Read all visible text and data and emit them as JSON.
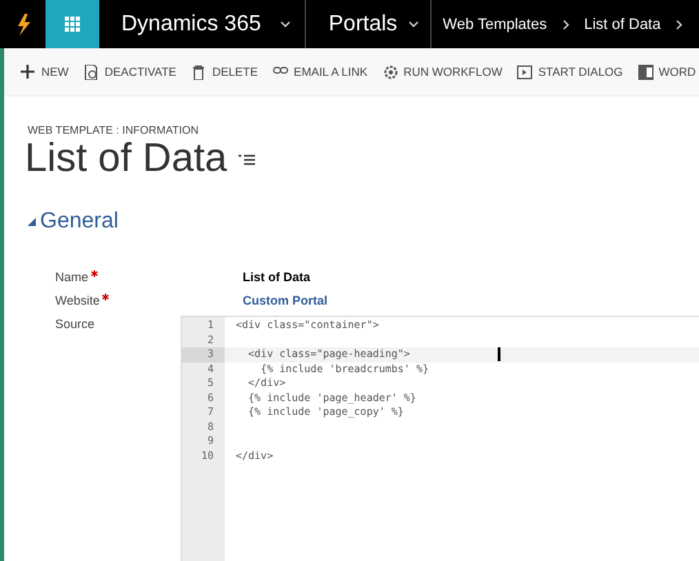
{
  "nav": {
    "product": "Dynamics 365",
    "area": "Portals",
    "breadcrumbs": [
      "Web Templates",
      "List of Data"
    ]
  },
  "toolbar": [
    {
      "kind": "new",
      "label": "NEW"
    },
    {
      "kind": "deactivate",
      "label": "DEACTIVATE"
    },
    {
      "kind": "delete",
      "label": "DELETE"
    },
    {
      "kind": "link",
      "label": "EMAIL A LINK"
    },
    {
      "kind": "workflow",
      "label": "RUN WORKFLOW"
    },
    {
      "kind": "dialog",
      "label": "START DIALOG"
    },
    {
      "kind": "word",
      "label": "WORD"
    }
  ],
  "record": {
    "entity": "WEB TEMPLATE : INFORMATION",
    "title": "List of Data"
  },
  "section": {
    "title": "General",
    "expanded": true
  },
  "fields": [
    {
      "label": "Name",
      "required": true,
      "value": "List of Data",
      "link": false
    },
    {
      "label": "Website",
      "required": true,
      "value": "Custom Portal",
      "link": true
    }
  ],
  "source": {
    "label": "Source",
    "lines": [
      {
        "number": "1",
        "text": "<div class=\"container\">",
        "active": false
      },
      {
        "number": "2",
        "active": false
      },
      {
        "number": "3",
        "text": "  <div class=\"page-heading\">",
        "active": true
      },
      {
        "number": "4",
        "text": "    {% include 'breadcrumbs' %}",
        "active": false
      },
      {
        "number": "5",
        "text": "  </div>",
        "active": false
      },
      {
        "number": "6",
        "text": "  {% include 'page_header' %}",
        "active": false
      },
      {
        "number": "7",
        "text": "  {% include 'page_copy' %}",
        "active": false
      },
      {
        "number": "8",
        "active": false
      },
      {
        "number": "9",
        "active": false
      },
      {
        "number": "10",
        "text": "</div>",
        "active": false
      }
    ]
  }
}
